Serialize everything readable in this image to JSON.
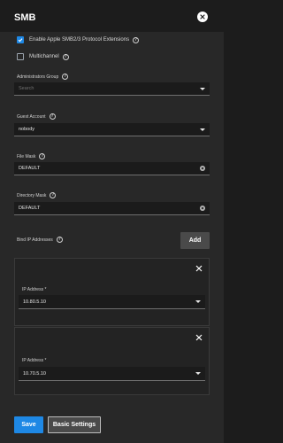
{
  "header": {
    "title": "SMB",
    "close_icon": "close-circle-icon"
  },
  "options": {
    "apple_extensions": {
      "label": "Enable Apple SMB2/3 Protocol Extensions",
      "checked": true
    },
    "multichannel": {
      "label": "Multichannel",
      "checked": false
    }
  },
  "fields": {
    "admin_group": {
      "label": "Administrators Group",
      "placeholder": "Search",
      "value": ""
    },
    "guest_account": {
      "label": "Guest Account",
      "value": "nobody"
    },
    "file_mask": {
      "label": "File Mask",
      "value": "DEFAULT"
    },
    "directory_mask": {
      "label": "Directory Mask",
      "value": "DEFAULT"
    }
  },
  "bind_ip": {
    "label": "Bind IP Addresses",
    "add_label": "Add",
    "entries": [
      {
        "label": "IP Address *",
        "value": "10.80.5.10"
      },
      {
        "label": "IP Address *",
        "value": "10.70.5.10"
      }
    ]
  },
  "footer": {
    "save_label": "Save",
    "basic_settings_label": "Basic Settings"
  },
  "colors": {
    "accent": "#1e88e5",
    "background": "#282828",
    "header_background": "#1c1c1c"
  },
  "help_icon": "?"
}
